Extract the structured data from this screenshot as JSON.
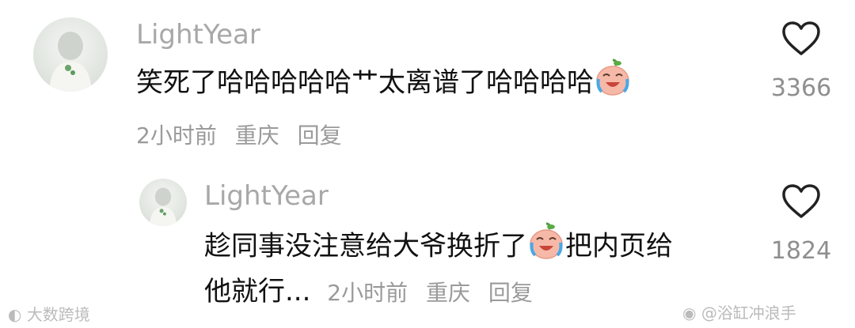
{
  "main_comment": {
    "username": "LightYear",
    "text_before": "笑死了哈哈哈哈哈艹太离谱了哈哈哈哈",
    "emoji_name": "laugh-cry-emoji",
    "time": "2小时前",
    "location": "重庆",
    "reply_label": "回复",
    "like_count": "3366"
  },
  "reply_comment": {
    "username": "LightYear",
    "text_line1_before": "趁同事没注意给大爷换折了",
    "emoji_name": "laugh-cry-emoji",
    "text_line1_after": "把内页给",
    "text_line2": "他就行...",
    "time": "2小时前",
    "location": "重庆",
    "reply_label": "回复",
    "like_count": "1824"
  },
  "watermark": {
    "left": "大数跨境",
    "right": "@浴缸冲浪手"
  },
  "colors": {
    "username": "#a8a8a8",
    "text": "#111111",
    "meta": "#9a9a9a",
    "heart_stroke": "#222222"
  }
}
